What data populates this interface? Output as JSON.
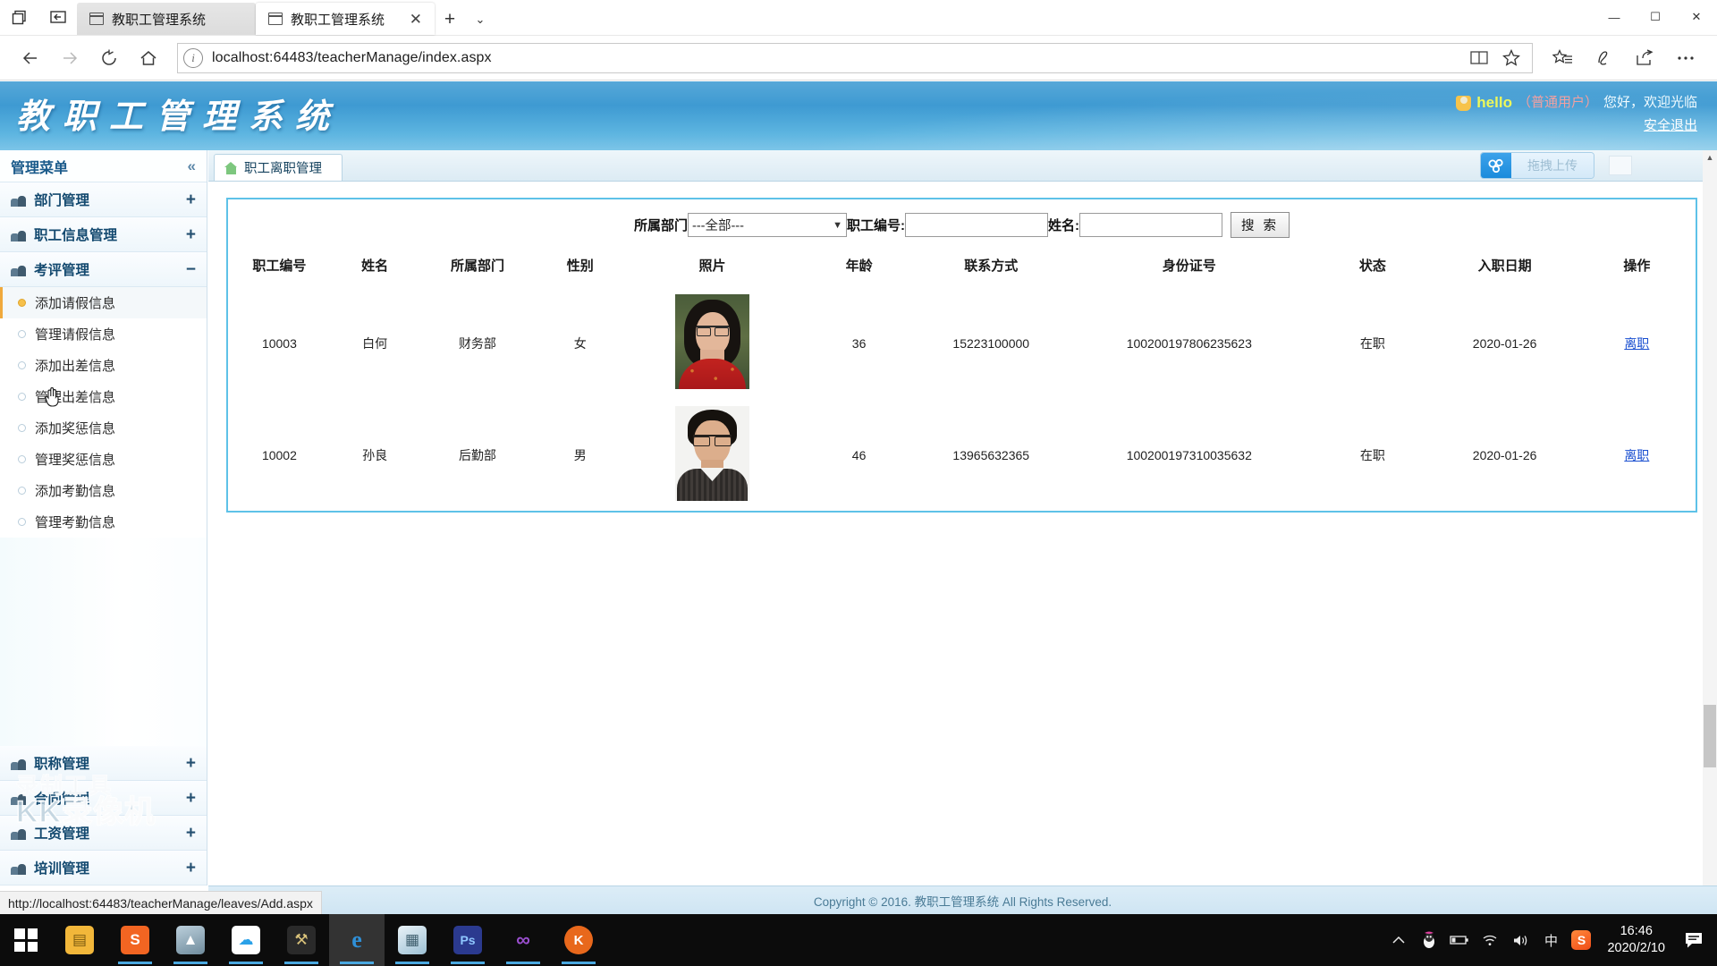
{
  "browser": {
    "window_icons": [
      "restore-down-icon",
      "collapse-tabs-icon"
    ],
    "tabs": [
      {
        "title": "教职工管理系统",
        "active": false
      },
      {
        "title": "教职工管理系统",
        "active": true
      }
    ],
    "new_tab_label": "+",
    "tab_menu_label": "⌄",
    "window_controls": {
      "minimize": "—",
      "maximize": "☐",
      "close": "✕"
    },
    "nav": {
      "back": "←",
      "forward": "→",
      "refresh": "⟳",
      "home": "⌂"
    },
    "url": "localhost:64483/teacherManage/index.aspx",
    "url_icons": [
      "reading-view-icon",
      "favorite-star-icon"
    ],
    "toolbar_icons": [
      "favorites-hub-icon",
      "web-note-icon",
      "share-icon",
      "more-icon"
    ]
  },
  "site": {
    "logo_text": "教职工管理系统",
    "user": {
      "name": "hello",
      "role": "（普通用户）",
      "greeting": "您好，欢迎光临",
      "logout": "安全退出"
    }
  },
  "sidebar": {
    "title": "管理菜单",
    "collapse_icon": "«",
    "groups_top": [
      {
        "label": "部门管理",
        "sign": "+"
      },
      {
        "label": "职工信息管理",
        "sign": "+"
      },
      {
        "label": "考评管理",
        "sign": "−"
      }
    ],
    "sub_items": [
      {
        "label": "添加请假信息",
        "highlighted": true
      },
      {
        "label": "管理请假信息",
        "highlighted": false
      },
      {
        "label": "添加出差信息",
        "highlighted": false
      },
      {
        "label": "管理出差信息",
        "highlighted": false
      },
      {
        "label": "添加奖惩信息",
        "highlighted": false
      },
      {
        "label": "管理奖惩信息",
        "highlighted": false
      },
      {
        "label": "添加考勤信息",
        "highlighted": false
      },
      {
        "label": "管理考勤信息",
        "highlighted": false
      }
    ],
    "groups_bottom": [
      {
        "label": "职称管理",
        "sign": "+"
      },
      {
        "label": "合同管理",
        "sign": "+"
      },
      {
        "label": "工资管理",
        "sign": "+"
      },
      {
        "label": "培训管理",
        "sign": "+"
      }
    ],
    "watermark": {
      "line1": "录制工具",
      "line2": "KK录像机"
    }
  },
  "main": {
    "tab_label": "职工离职管理",
    "upload_button": "拖拽上传",
    "search": {
      "dept_label": "所属部门",
      "dept_value": "---全部---",
      "dept_options": [
        "---全部---"
      ],
      "emp_no_label": "职工编号:",
      "emp_no_value": "",
      "name_label": "姓名:",
      "name_value": "",
      "search_button": "搜 索"
    },
    "table": {
      "headers": [
        "职工编号",
        "姓名",
        "所属部门",
        "性别",
        "照片",
        "年龄",
        "联系方式",
        "身份证号",
        "状态",
        "入职日期",
        "操作"
      ],
      "rows": [
        {
          "emp_no": "10003",
          "name": "白何",
          "dept": "财务部",
          "gender": "女",
          "photo": "female-portrait",
          "age": "36",
          "phone": "15223100000",
          "id_card": "100200197806235623",
          "status": "在职",
          "hire_date": "2020-01-26",
          "action": "离职"
        },
        {
          "emp_no": "10002",
          "name": "孙良",
          "dept": "后勤部",
          "gender": "男",
          "photo": "male-portrait",
          "age": "46",
          "phone": "13965632365",
          "id_card": "100200197310035632",
          "status": "在职",
          "hire_date": "2020-01-26",
          "action": "离职"
        }
      ]
    },
    "footer": "Copyright © 2016. 教职工管理系统 All Rights Reserved."
  },
  "status_bar": {
    "url": "http://localhost:64483/teacherManage/leaves/Add.aspx"
  },
  "taskbar": {
    "start": "windows-logo",
    "items": [
      {
        "name": "file-explorer",
        "glyph": "🗂",
        "color": "#f2b73a",
        "running": false,
        "active": false
      },
      {
        "name": "sogou-browser",
        "glyph": "🦊",
        "color": "#f26522",
        "running": true,
        "active": false
      },
      {
        "name": "photo-viewer",
        "glyph": "🖼",
        "color": "#8aa5b5",
        "running": true,
        "active": false
      },
      {
        "name": "baidu-netdisk",
        "glyph": "☁",
        "color": "#ffffff",
        "running": true,
        "active": false
      },
      {
        "name": "dev-tools",
        "glyph": "🛠",
        "color": "#d9c27a",
        "running": true,
        "active": false
      },
      {
        "name": "microsoft-edge",
        "glyph": "e",
        "color": "#0f7fc4",
        "running": true,
        "active": true
      },
      {
        "name": "notepad-app",
        "glyph": "📘",
        "color": "#b9d6e6",
        "running": true,
        "active": false
      },
      {
        "name": "photoshop",
        "glyph": "Ps",
        "color": "#2b3a8f",
        "running": true,
        "active": false
      },
      {
        "name": "visual-studio",
        "glyph": "∞",
        "color": "#8a3fc0",
        "running": true,
        "active": false
      },
      {
        "name": "kk-recorder",
        "glyph": "🐱",
        "color": "#e8681c",
        "running": true,
        "active": false
      }
    ],
    "tray": {
      "icons": [
        "show-hidden-icons",
        "qq-penguin-icon",
        "battery-icon",
        "wifi-icon",
        "volume-icon",
        "ime-chinese-icon",
        "sogou-input-icon"
      ],
      "ime_label": "中",
      "time": "16:46",
      "date": "2020/2/10",
      "notification_icon": "action-center-icon"
    }
  },
  "colors": {
    "header_blue": "#3e9ad2",
    "panel_border": "#5ec2e8",
    "link_blue": "#1a4fd0",
    "accent_yellow": "#edf75a"
  }
}
